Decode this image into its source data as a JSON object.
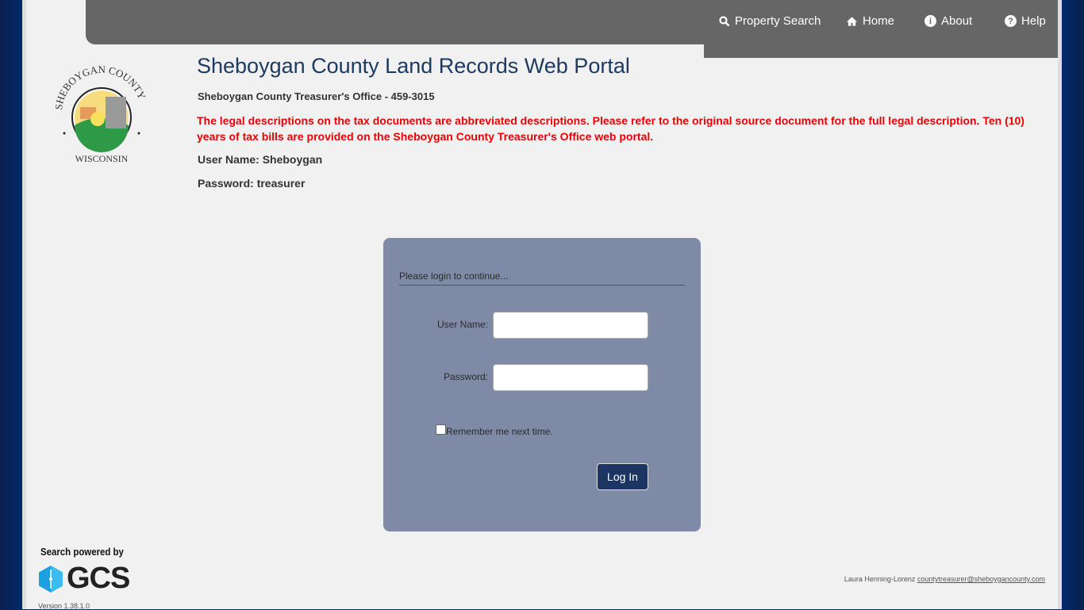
{
  "nav": {
    "items": [
      {
        "label": "Property Search",
        "icon": "search-icon"
      },
      {
        "label": "Home",
        "icon": "home-icon"
      },
      {
        "label": "About",
        "icon": "info-icon"
      },
      {
        "label": "Help",
        "icon": "question-icon"
      }
    ]
  },
  "logo": {
    "top_text": "SHEBOYGAN COUNTY",
    "bottom_text": "WISCONSIN"
  },
  "header": {
    "title": "Sheboygan County Land Records Web Portal",
    "office": "Sheboygan County Treasurer's Office - 459-3015",
    "notice": "The legal descriptions on the tax documents are abbreviated descriptions. Please refer to the original source document for the full legal description. Ten (10) years of tax bills are provided on the Sheboygan County Treasurer's Office web portal.",
    "username_hint": "User Name: Sheboygan",
    "password_hint": "Password: treasurer"
  },
  "login": {
    "prompt": "Please login to continue...",
    "username_label": "User Name:",
    "username_value": "",
    "password_label": "Password:",
    "password_value": "",
    "remember_label": "Remember me next time.",
    "remember_checked": false,
    "submit": "Log In"
  },
  "footer": {
    "powered_by": "Search powered by",
    "brand": "GCS",
    "version": "Version 1.38.1.0",
    "contact_name": "Laura Henning-Lorenz",
    "contact_email": "countytreasurer@sheboygancounty.com"
  },
  "colors": {
    "header_bg": "#666666",
    "title": "#1d3a63",
    "notice": "#ee0000",
    "login_panel": "#7f8ba6",
    "button": "#1d3563"
  }
}
